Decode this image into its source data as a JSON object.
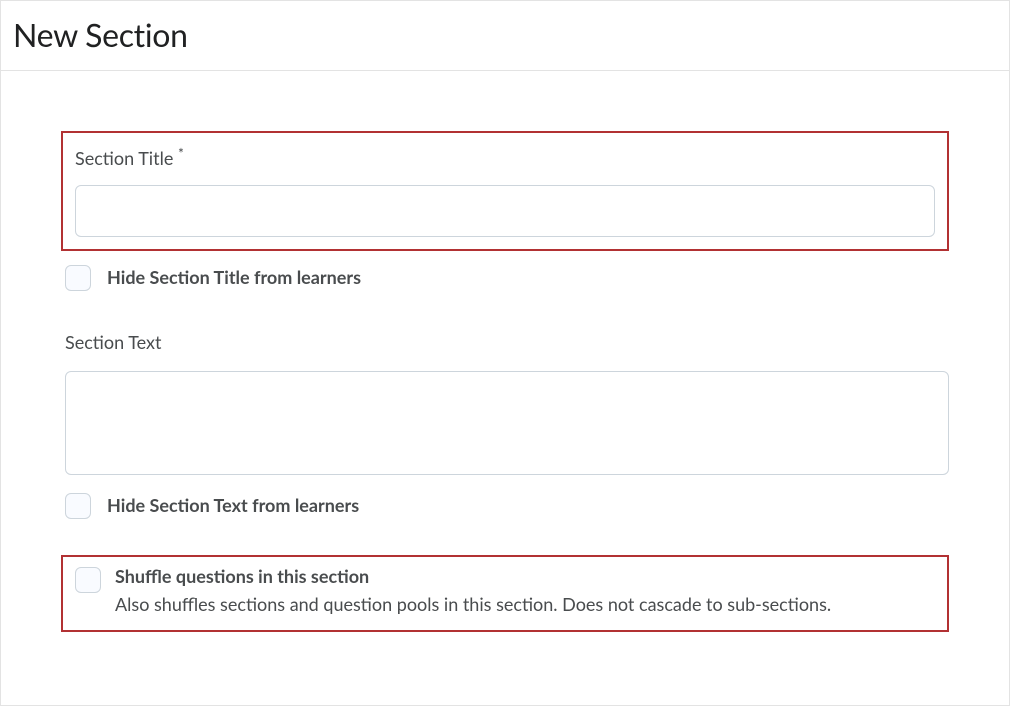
{
  "header": {
    "title": "New Section"
  },
  "form": {
    "section_title": {
      "label": "Section Title ",
      "required_mark": "*",
      "value": ""
    },
    "hide_title": {
      "label": "Hide Section Title from learners",
      "checked": false
    },
    "section_text": {
      "label": "Section Text",
      "value": ""
    },
    "hide_text": {
      "label": "Hide Section Text from learners",
      "checked": false
    },
    "shuffle": {
      "label": "Shuffle questions in this section",
      "sub": "Also shuffles sections and question pools in this section. Does not cascade to sub-sections.",
      "checked": false
    }
  }
}
